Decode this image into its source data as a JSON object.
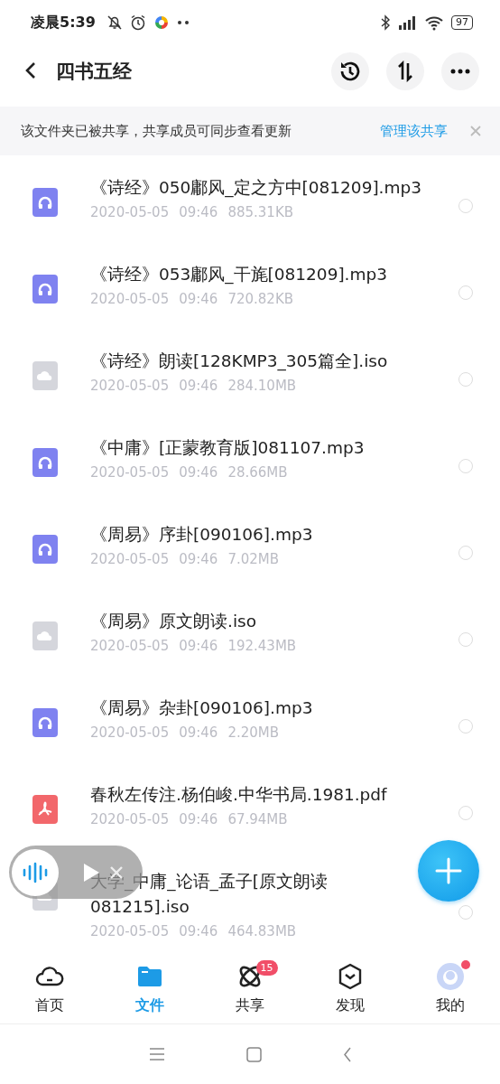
{
  "status_bar": {
    "time": "凌晨5:39",
    "battery": "97"
  },
  "header": {
    "title": "四书五经"
  },
  "banner": {
    "text": "该文件夹已被共享，共享成员可同步查看更新",
    "link": "管理该共享"
  },
  "files": [
    {
      "kind": "audio",
      "name": "《诗经》050鄘风_定之方中[081209].mp3",
      "date": "2020-05-05",
      "time": "09:46",
      "size": "885.31KB",
      "selected": false
    },
    {
      "kind": "audio",
      "name": "《诗经》053鄘风_干旄[081209].mp3",
      "date": "2020-05-05",
      "time": "09:46",
      "size": "720.82KB",
      "selected": false
    },
    {
      "kind": "disk",
      "name": "《诗经》朗读[128KMP3_305篇全].iso",
      "date": "2020-05-05",
      "time": "09:46",
      "size": "284.10MB",
      "selected": false
    },
    {
      "kind": "audio",
      "name": "《中庸》[正蒙教育版]081107.mp3",
      "date": "2020-05-05",
      "time": "09:46",
      "size": "28.66MB",
      "selected": false
    },
    {
      "kind": "audio",
      "name": "《周易》序卦[090106].mp3",
      "date": "2020-05-05",
      "time": "09:46",
      "size": "7.02MB",
      "selected": false
    },
    {
      "kind": "disk",
      "name": "《周易》原文朗读.iso",
      "date": "2020-05-05",
      "time": "09:46",
      "size": "192.43MB",
      "selected": false
    },
    {
      "kind": "audio",
      "name": "《周易》杂卦[090106].mp3",
      "date": "2020-05-05",
      "time": "09:46",
      "size": "2.20MB",
      "selected": false
    },
    {
      "kind": "pdf",
      "name": "春秋左传注.杨伯峻.中华书局.1981.pdf",
      "date": "2020-05-05",
      "time": "09:46",
      "size": "67.94MB",
      "selected": false
    },
    {
      "kind": "disk",
      "name": "大学_中庸_论语_孟子[原文朗读081215].iso",
      "date": "2020-05-05",
      "time": "09:46",
      "size": "464.83MB",
      "selected": false
    }
  ],
  "tabs": [
    {
      "kind": "home",
      "label": "首页",
      "selected": false
    },
    {
      "kind": "files",
      "label": "文件",
      "selected": true
    },
    {
      "kind": "share",
      "label": "共享",
      "selected": false,
      "badge": "15"
    },
    {
      "kind": "discover",
      "label": "发现",
      "selected": false
    },
    {
      "kind": "me",
      "label": "我的",
      "selected": false,
      "dot": true
    }
  ]
}
